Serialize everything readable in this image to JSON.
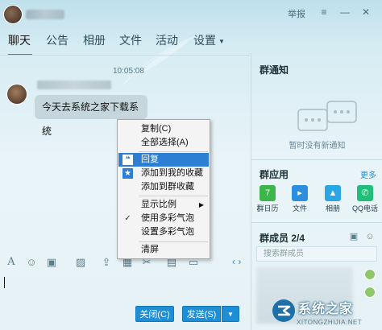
{
  "titlebar": {
    "report_label": "举报",
    "menu_icon": "hamburger-icon",
    "minimize_icon": "minimize-icon",
    "close_icon": "close-icon"
  },
  "tabs": [
    {
      "label": "聊天",
      "active": true
    },
    {
      "label": "公告"
    },
    {
      "label": "相册"
    },
    {
      "label": "文件"
    },
    {
      "label": "活动"
    },
    {
      "label": "设置",
      "has_dropdown": true
    }
  ],
  "chat": {
    "timestamp": "10:05:08",
    "message_text": "今天去系统之家下载系统"
  },
  "context_menu": {
    "items": [
      {
        "label": "复制(C)"
      },
      {
        "label": "全部选择(A)"
      },
      {
        "label": "回复",
        "highlighted": true,
        "icon": "reply-icon"
      },
      {
        "label": "添加到我的收藏",
        "icon": "star-icon"
      },
      {
        "label": "添加到群收藏"
      },
      {
        "label": "显示比例",
        "submenu": true
      },
      {
        "label": "使用多彩气泡",
        "checked": true
      },
      {
        "label": "设置多彩气泡"
      },
      {
        "label": "清屏"
      }
    ]
  },
  "buttons": {
    "close": "关闭(C)",
    "send": "发送(S)"
  },
  "right_panel": {
    "notice_title": "群通知",
    "notice_empty": "暂时没有新通知",
    "apps_title": "群应用",
    "more_label": "更多",
    "apps": [
      {
        "label": "群日历",
        "color": "#3cb64a",
        "icon": "calendar-icon",
        "glyph": "7"
      },
      {
        "label": "文件",
        "color": "#2d8ee0",
        "icon": "folder-icon",
        "glyph": "▸"
      },
      {
        "label": "相册",
        "color": "#2aa5e6",
        "icon": "photo-icon",
        "glyph": "▲"
      },
      {
        "label": "QQ电话",
        "color": "#1fbf7a",
        "icon": "phone-icon",
        "glyph": "✆"
      }
    ],
    "members_title": "群成员 2/4",
    "member_search_placeholder": "搜索群成员"
  },
  "watermark": {
    "text": "系统之家",
    "url": "XITONGZHIJIA.NET"
  },
  "colors": {
    "accent": "#1e8fd6",
    "menu_highlight": "#2d7fd3",
    "background": "#e6f2f6"
  }
}
